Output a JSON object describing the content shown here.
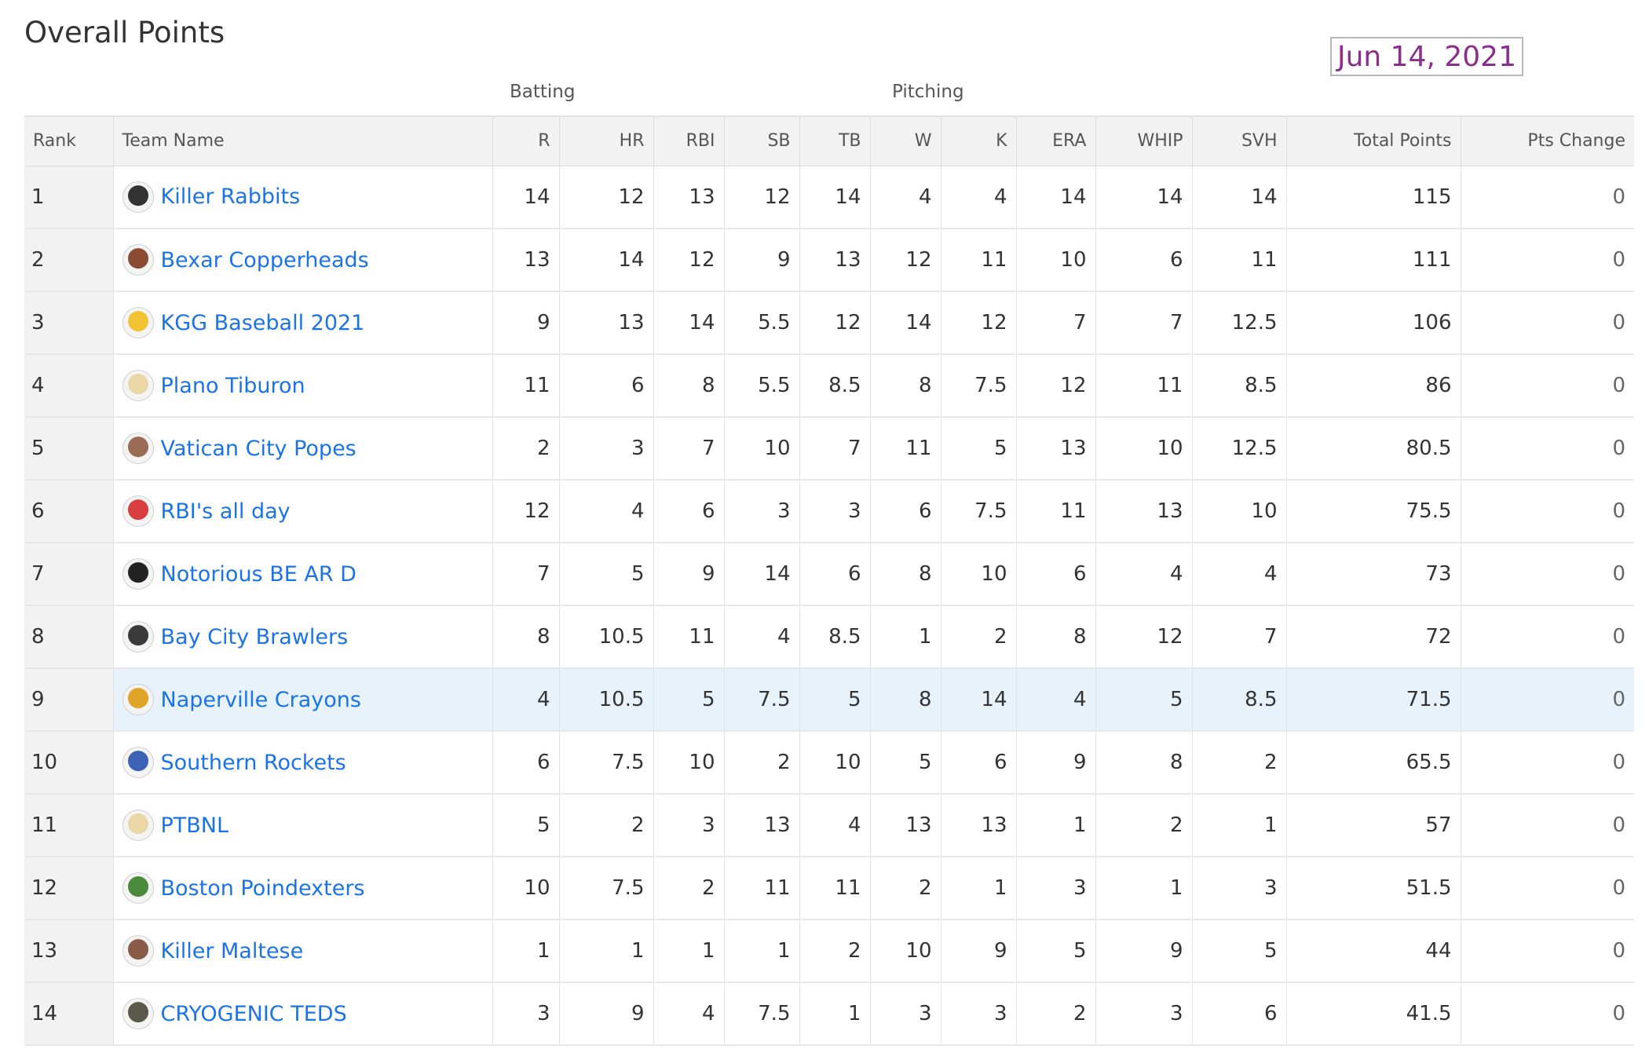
{
  "page": {
    "title": "Overall Points",
    "date": "Jun 14, 2021"
  },
  "groups": {
    "batting": "Batting",
    "pitching": "Pitching"
  },
  "columns": [
    "Rank",
    "Team Name",
    "R",
    "HR",
    "RBI",
    "SB",
    "TB",
    "W",
    "K",
    "ERA",
    "WHIP",
    "SVH",
    "Total Points",
    "Pts Change"
  ],
  "colors": {
    "link": "#1a73e8",
    "date_text": "#8b2f8b",
    "highlight_row": "#e8f2fb",
    "header_bg": "#f2f2f2"
  },
  "highlighted_rank": "9",
  "rows": [
    {
      "rank": "1",
      "team": "Killer Rabbits",
      "logo_icon": "rabbit-logo-icon",
      "logo_color": "#333333",
      "R": "14",
      "HR": "12",
      "RBI": "13",
      "SB": "12",
      "TB": "14",
      "W": "4",
      "K": "4",
      "ERA": "14",
      "WHIP": "14",
      "SVH": "14",
      "total": "115",
      "change": "0"
    },
    {
      "rank": "2",
      "team": "Bexar Copperheads",
      "logo_icon": "snake-logo-icon",
      "logo_color": "#8b4a32",
      "R": "13",
      "HR": "14",
      "RBI": "12",
      "SB": "9",
      "TB": "13",
      "W": "12",
      "K": "11",
      "ERA": "10",
      "WHIP": "6",
      "SVH": "11",
      "total": "111",
      "change": "0"
    },
    {
      "rank": "3",
      "team": "KGG Baseball 2021",
      "logo_icon": "cap-logo-icon",
      "logo_color": "#f1c232",
      "R": "9",
      "HR": "13",
      "RBI": "14",
      "SB": "5.5",
      "TB": "12",
      "W": "14",
      "K": "12",
      "ERA": "7",
      "WHIP": "7",
      "SVH": "12.5",
      "total": "106",
      "change": "0"
    },
    {
      "rank": "4",
      "team": "Plano Tiburon",
      "logo_icon": "cap-logo-icon",
      "logo_color": "#e9d8a6",
      "R": "11",
      "HR": "6",
      "RBI": "8",
      "SB": "5.5",
      "TB": "8.5",
      "W": "8",
      "K": "7.5",
      "ERA": "12",
      "WHIP": "11",
      "SVH": "8.5",
      "total": "86",
      "change": "0"
    },
    {
      "rank": "5",
      "team": "Vatican City Popes",
      "logo_icon": "photo-logo-icon",
      "logo_color": "#9a6b55",
      "R": "2",
      "HR": "3",
      "RBI": "7",
      "SB": "10",
      "TB": "7",
      "W": "11",
      "K": "5",
      "ERA": "13",
      "WHIP": "10",
      "SVH": "12.5",
      "total": "80.5",
      "change": "0"
    },
    {
      "rank": "6",
      "team": "RBI's all day",
      "logo_icon": "helmet-logo-icon",
      "logo_color": "#d93f3f",
      "R": "12",
      "HR": "4",
      "RBI": "6",
      "SB": "3",
      "TB": "3",
      "W": "6",
      "K": "7.5",
      "ERA": "11",
      "WHIP": "13",
      "SVH": "10",
      "total": "75.5",
      "change": "0"
    },
    {
      "rank": "7",
      "team": "Notorious BE AR D",
      "logo_icon": "seal-logo-icon",
      "logo_color": "#222222",
      "R": "7",
      "HR": "5",
      "RBI": "9",
      "SB": "14",
      "TB": "6",
      "W": "8",
      "K": "10",
      "ERA": "6",
      "WHIP": "4",
      "SVH": "4",
      "total": "73",
      "change": "0"
    },
    {
      "rank": "8",
      "team": "Bay City Brawlers",
      "logo_icon": "dog-logo-icon",
      "logo_color": "#3a3a3a",
      "R": "8",
      "HR": "10.5",
      "RBI": "11",
      "SB": "4",
      "TB": "8.5",
      "W": "1",
      "K": "2",
      "ERA": "8",
      "WHIP": "12",
      "SVH": "7",
      "total": "72",
      "change": "0"
    },
    {
      "rank": "9",
      "team": "Naperville Crayons",
      "logo_icon": "crayon-logo-icon",
      "logo_color": "#e0a526",
      "R": "4",
      "HR": "10.5",
      "RBI": "5",
      "SB": "7.5",
      "TB": "5",
      "W": "8",
      "K": "14",
      "ERA": "4",
      "WHIP": "5",
      "SVH": "8.5",
      "total": "71.5",
      "change": "0"
    },
    {
      "rank": "10",
      "team": "Southern Rockets",
      "logo_icon": "rocket-logo-icon",
      "logo_color": "#3d63b8",
      "R": "6",
      "HR": "7.5",
      "RBI": "10",
      "SB": "2",
      "TB": "10",
      "W": "5",
      "K": "6",
      "ERA": "9",
      "WHIP": "8",
      "SVH": "2",
      "total": "65.5",
      "change": "0"
    },
    {
      "rank": "11",
      "team": "PTBNL",
      "logo_icon": "cap-logo-icon",
      "logo_color": "#e9d8a6",
      "R": "5",
      "HR": "2",
      "RBI": "3",
      "SB": "13",
      "TB": "4",
      "W": "13",
      "K": "13",
      "ERA": "1",
      "WHIP": "2",
      "SVH": "1",
      "total": "57",
      "change": "0"
    },
    {
      "rank": "12",
      "team": "Boston Poindexters",
      "logo_icon": "dino-logo-icon",
      "logo_color": "#4a8a3a",
      "R": "10",
      "HR": "7.5",
      "RBI": "2",
      "SB": "11",
      "TB": "11",
      "W": "2",
      "K": "1",
      "ERA": "3",
      "WHIP": "1",
      "SVH": "3",
      "total": "51.5",
      "change": "0"
    },
    {
      "rank": "13",
      "team": "Killer Maltese",
      "logo_icon": "photo-logo-icon",
      "logo_color": "#8a5a48",
      "R": "1",
      "HR": "1",
      "RBI": "1",
      "SB": "1",
      "TB": "2",
      "W": "10",
      "K": "9",
      "ERA": "5",
      "WHIP": "9",
      "SVH": "5",
      "total": "44",
      "change": "0"
    },
    {
      "rank": "14",
      "team": "CRYOGENIC TEDS",
      "logo_icon": "jar-logo-icon",
      "logo_color": "#5a5a4a",
      "R": "3",
      "HR": "9",
      "RBI": "4",
      "SB": "7.5",
      "TB": "1",
      "W": "3",
      "K": "3",
      "ERA": "2",
      "WHIP": "3",
      "SVH": "6",
      "total": "41.5",
      "change": "0"
    }
  ]
}
